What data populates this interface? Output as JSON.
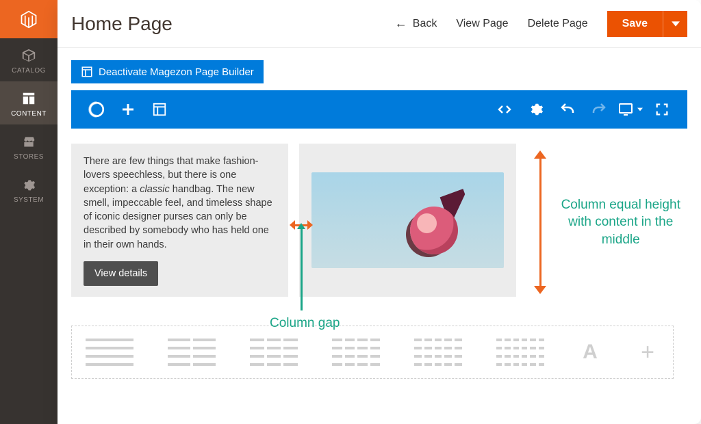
{
  "sidebar": {
    "items": [
      {
        "label": "CATALOG"
      },
      {
        "label": "CONTENT"
      },
      {
        "label": "STORES"
      },
      {
        "label": "SYSTEM"
      }
    ]
  },
  "header": {
    "title": "Home Page",
    "back": "Back",
    "view": "View Page",
    "delete": "Delete Page",
    "save": "Save"
  },
  "builder": {
    "deactivate": "Deactivate Magezon Page Builder",
    "card": {
      "text_plain_prefix": "There are few things that make fashion-lovers speechless, but there is one exception: a ",
      "text_italic": "classic",
      "text_plain_suffix": " handbag. The new smell, impeccable feel, and timeless shape of iconic designer purses can only be described by somebody who has held one in their own hands.",
      "button": "View details"
    }
  },
  "annotations": {
    "right": "Column equal height with content in the middle",
    "gap": "Column gap"
  },
  "presets": {
    "letter": "A",
    "plus": "+"
  },
  "colors": {
    "brand_orange": "#eb5202",
    "builder_blue": "#007bdb",
    "anno_green": "#1aa587"
  }
}
